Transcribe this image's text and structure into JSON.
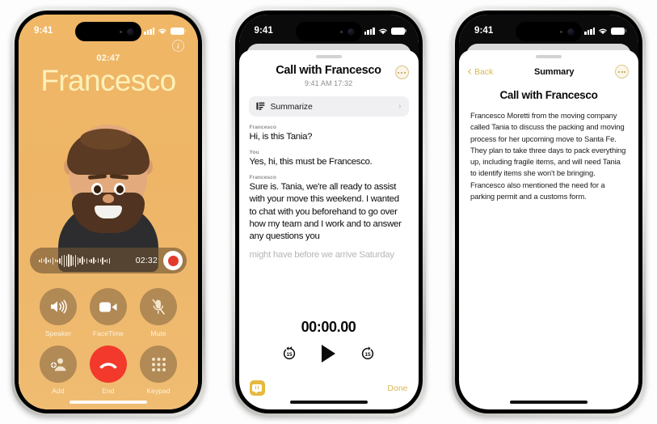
{
  "phone1": {
    "status": {
      "time": "9:41",
      "signal_icon": "cellular-bars-icon",
      "wifi_icon": "wifi-icon",
      "battery_icon": "battery-icon"
    },
    "info_button": "i",
    "call_duration": "02:47",
    "caller_name": "Francesco",
    "avatar": "memoji-avatar",
    "recording": {
      "time": "02:32",
      "record_button": "record-button",
      "waveform": "audio-waveform"
    },
    "controls": [
      {
        "label": "Speaker",
        "icon": "speaker-icon"
      },
      {
        "label": "FaceTime",
        "icon": "video-camera-icon"
      },
      {
        "label": "Mute",
        "icon": "microphone-muted-icon"
      },
      {
        "label": "Add",
        "icon": "add-person-icon"
      },
      {
        "label": "End",
        "icon": "end-call-icon"
      },
      {
        "label": "Keypad",
        "icon": "keypad-icon"
      }
    ]
  },
  "phone2": {
    "status": {
      "time": "9:41",
      "signal_icon": "cellular-bars-icon",
      "wifi_icon": "wifi-icon",
      "battery_icon": "battery-icon"
    },
    "title": "Call with Francesco",
    "subtitle": "9:41 AM  17:32",
    "more_button": "more-options-icon",
    "summarize": {
      "label": "Summarize",
      "icon": "document-lines-icon",
      "chevron": "›"
    },
    "transcript": [
      {
        "speaker": "Francesco",
        "text": "Hi, is this Tania?",
        "faded": false
      },
      {
        "speaker": "You",
        "text": "Yes, hi, this must be Francesco.",
        "faded": false
      },
      {
        "speaker": "Francesco",
        "text": "Sure is. Tania, we're all ready to assist with your move this weekend. I wanted to chat with you beforehand to go over how my team and I work and to answer any questions you",
        "faded": false
      },
      {
        "speaker": "",
        "text": "might have before we arrive Saturday",
        "faded": true
      }
    ],
    "player": {
      "time": "00:00.00",
      "skip_back": "15",
      "skip_forward": "15",
      "play_icon": "play-icon",
      "skip_back_icon": "skip-back-15-icon",
      "skip_forward_icon": "skip-forward-15-icon"
    },
    "footer": {
      "transcript_icon": "quote-bubble-icon",
      "done_label": "Done"
    }
  },
  "phone3": {
    "status": {
      "time": "9:41",
      "signal_icon": "cellular-bars-icon",
      "wifi_icon": "wifi-icon",
      "battery_icon": "battery-icon"
    },
    "back_label": "Back",
    "nav_title": "Summary",
    "more_button": "more-options-icon",
    "title": "Call with Francesco",
    "body": "Francesco Moretti from the moving company called Tania to discuss the packing and moving process for her upcoming move to Santa Fe. They plan to take three days to pack everything up, including fragile items, and will need Tania to identify items she won't be bringing. Francesco also mentioned the need for a parking permit and a customs form."
  },
  "colors": {
    "call_background": "#efb766",
    "caller_name": "#fdf0b9",
    "end_call_red": "#f2392c",
    "accent_gold": "#d8b656",
    "quote_icon": "#e6b93f",
    "page_background": "#ffffff"
  }
}
